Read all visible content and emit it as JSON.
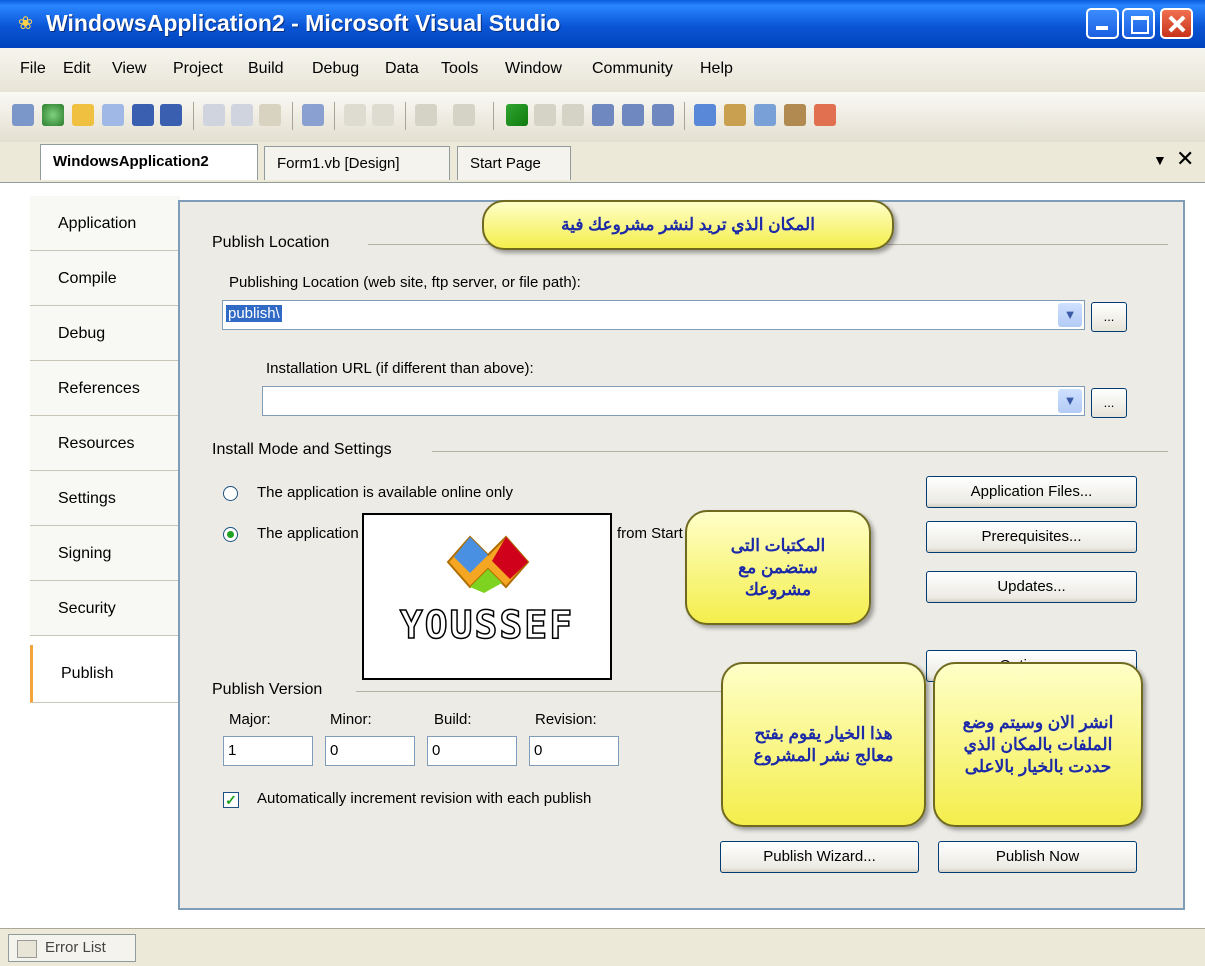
{
  "window": {
    "title": "WindowsApplication2 - Microsoft Visual Studio"
  },
  "menu": [
    "File",
    "Edit",
    "View",
    "Project",
    "Build",
    "Debug",
    "Data",
    "Tools",
    "Window",
    "Community",
    "Help"
  ],
  "doc_tabs": [
    "WindowsApplication2",
    "Form1.vb [Design]",
    "Start Page"
  ],
  "side_tabs": [
    "Application",
    "Compile",
    "Debug",
    "References",
    "Resources",
    "Settings",
    "Signing",
    "Security",
    "Publish"
  ],
  "active_side_tab": "Publish",
  "publish": {
    "location_group": "Publish Location",
    "location_label": "Publishing Location (web site, ftp server, or file path):",
    "location_value": "publish\\",
    "install_url_label": "Installation URL (if different than above):",
    "install_url_value": "",
    "mode_group": "Install Mode and Settings",
    "radio_online": "The application is available online only",
    "radio_offline": "The application is available offline as well (launchable from Start menu)",
    "buttons": {
      "application_files": "Application Files...",
      "prerequisites": "Prerequisites...",
      "updates": "Updates...",
      "options": "Options...",
      "publish_wizard": "Publish Wizard...",
      "publish_now": "Publish Now"
    },
    "version_group": "Publish Version",
    "version_labels": [
      "Major:",
      "Minor:",
      "Build:",
      "Revision:"
    ],
    "version_values": [
      "1",
      "0",
      "0",
      "0"
    ],
    "auto_increment_label": "Automatically increment revision with each publish",
    "auto_increment_checked": true
  },
  "callouts": {
    "location": "المكان الذي تريد لنشر مشروعك فية",
    "prereq": "المكتبات التى ستضمن مع مشروعك",
    "wizard": "هذا الخيار يقوم بفتح معالج نشر المشروع",
    "publish_now": "انشر الان وسيتم وضع الملفات بالمكان الذي حددت بالخيار بالاعلى"
  },
  "watermark": {
    "text": "YOUSSEF"
  },
  "bottom": {
    "error_list": "Error List"
  }
}
